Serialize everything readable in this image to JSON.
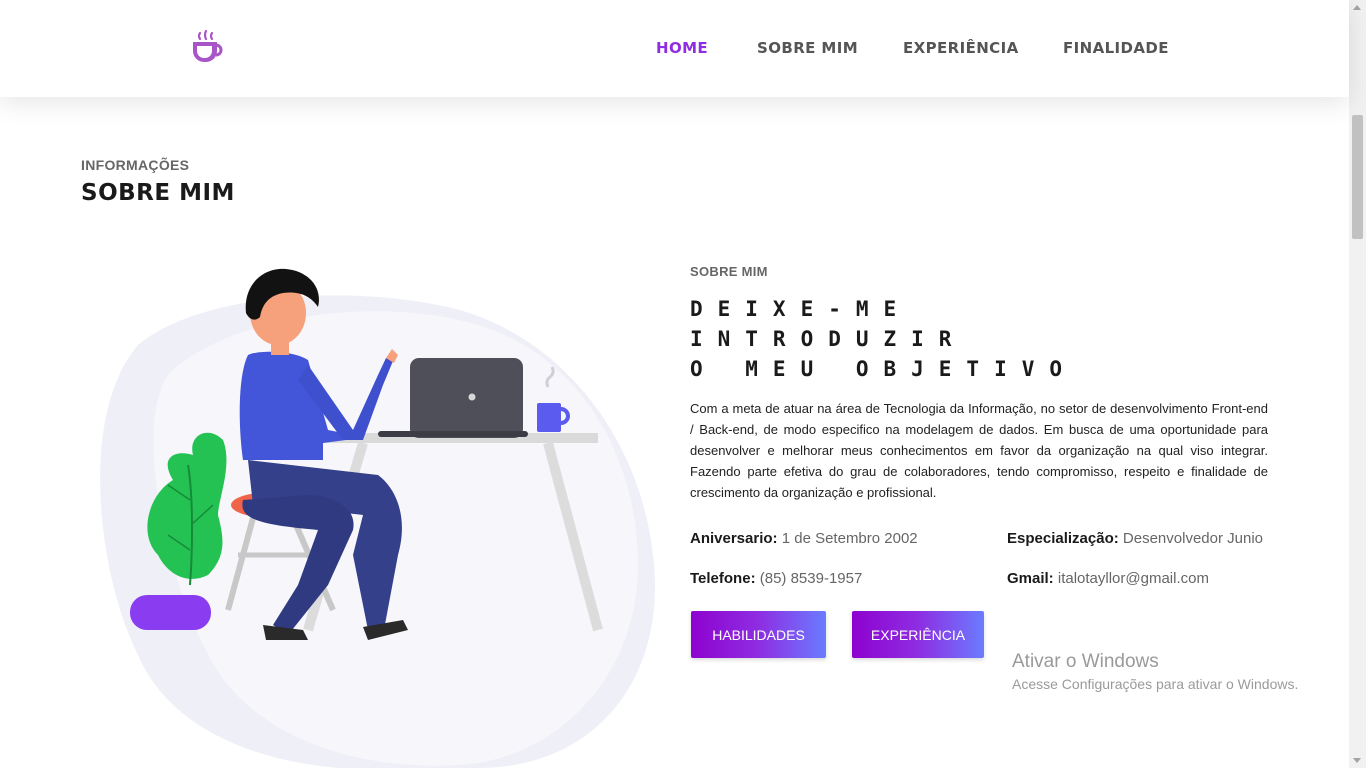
{
  "nav": {
    "items": [
      {
        "label": "HOME",
        "active": true
      },
      {
        "label": "SOBRE MIM",
        "active": false
      },
      {
        "label": "EXPERIÊNCIA",
        "active": false
      },
      {
        "label": "FINALIDADE",
        "active": false
      }
    ]
  },
  "brand": {
    "icon": "coffee-cup-icon",
    "color": "#a855c8"
  },
  "section": {
    "kicker": "INFORMAÇÕES",
    "title": "SOBRE MIM"
  },
  "about": {
    "kicker": "SOBRE MIM",
    "heading": [
      "DEIXE-ME",
      "INTRODUZIR",
      "O MEU OBJETIVO"
    ],
    "text": "Com a meta de atuar na área de Tecnologia da Informação, no setor de desenvolvimento Front-end / Back-end, de modo especifico na modelagem de dados. Em busca de uma oportunidade para desenvolver e melhorar meus conhecimentos em favor da organização na qual viso integrar. Fazendo parte efetiva do grau de colaboradores, tendo compromisso, respeito e finalidade de crescimento da organização e profissional.",
    "info": [
      {
        "label": "Aniversario:",
        "value": "1 de Setembro 2002"
      },
      {
        "label": "Especialização:",
        "value": "Desenvolvedor Junio"
      },
      {
        "label": "Telefone:",
        "value": "(85) 8539-1957"
      },
      {
        "label": "Gmail:",
        "value": "italotayllor@gmail.com"
      }
    ],
    "buttons": {
      "skills": "HABILIDADES",
      "experience": "EXPERIÊNCIA"
    }
  },
  "colors": {
    "accent": "#8e2de2",
    "button_start": "#8e02cf",
    "button_end": "#6a7cff"
  },
  "windows_watermark": {
    "title": "Ativar o Windows",
    "subtitle": "Acesse Configurações para ativar o Windows."
  }
}
